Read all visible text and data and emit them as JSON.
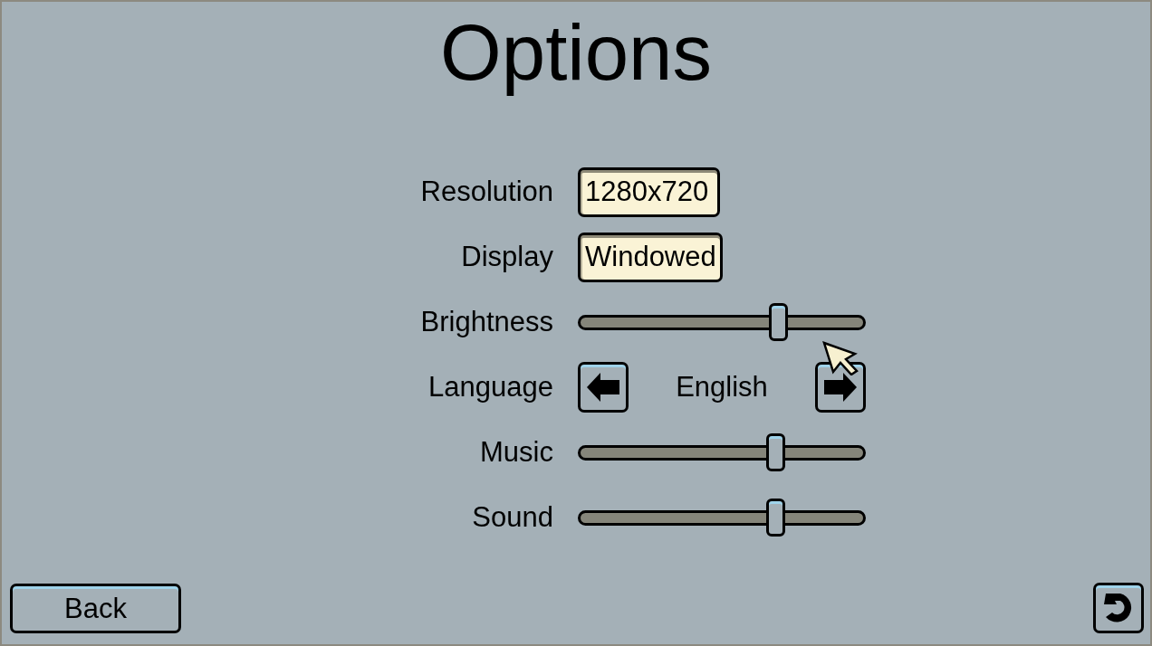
{
  "title": "Options",
  "settings": [
    {
      "kind": "field",
      "label": "Resolution",
      "value": "1280x720"
    },
    {
      "kind": "field",
      "label": "Display",
      "value": "Windowed"
    },
    {
      "kind": "slider",
      "label": "Brightness",
      "level": 0.7
    },
    {
      "kind": "selector",
      "label": "Language",
      "value": "English"
    },
    {
      "kind": "slider",
      "label": "Music",
      "level": 0.69
    },
    {
      "kind": "slider",
      "label": "Sound",
      "level": 0.69
    }
  ],
  "back_button": {
    "label": "Back"
  }
}
